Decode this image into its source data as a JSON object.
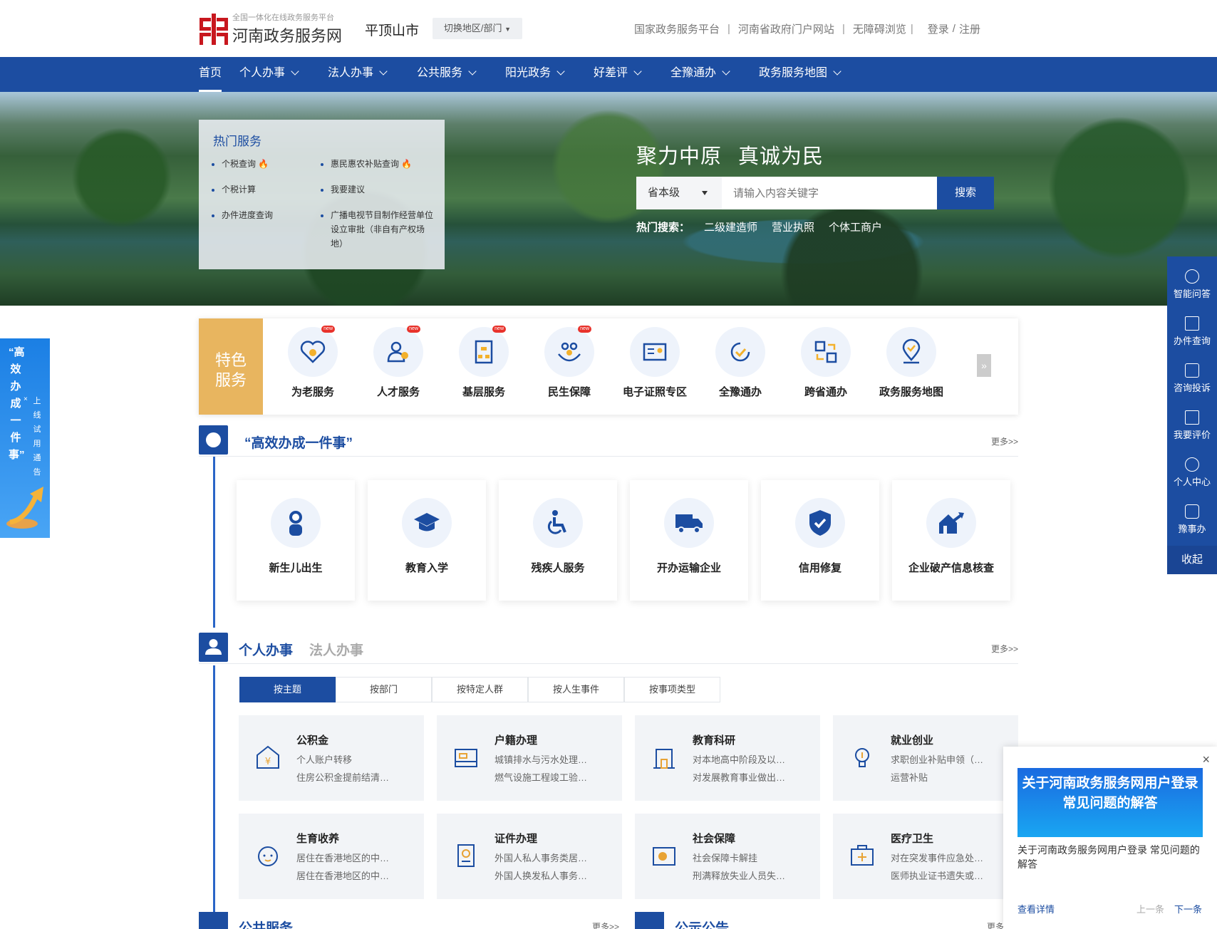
{
  "header": {
    "logo_sub": "全国一体化在线政务服务平台",
    "logo_main": "河南政务服务网",
    "city": "平顶山市",
    "switch_label": "切换地区/部门",
    "links": [
      "国家政务服务平台",
      "河南省政府门户网站",
      "无障碍浏览"
    ],
    "login": "登录",
    "register": "注册"
  },
  "nav": {
    "items": [
      "首页",
      "个人办事",
      "法人办事",
      "公共服务",
      "阳光政务",
      "好差评",
      "全豫通办",
      "政务服务地图"
    ]
  },
  "banner": {
    "hot_title": "热门服务",
    "hot_items": [
      "个税查询",
      "惠民惠农补贴查询",
      "个税计算",
      "我要建议",
      "办件进度查询",
      "广播电视节目制作经营单位设立审批（非自有产权场地）"
    ],
    "slogan": "聚力中原   真诚为民",
    "level": "省本级",
    "placeholder": "请输入内容关键字",
    "search_btn": "搜索",
    "hot_search_label": "热门搜索：",
    "hot_search": [
      "二级建造师",
      "营业执照",
      "个体工商户"
    ]
  },
  "right_sidebar": {
    "items": [
      "智能问答",
      "办件查询",
      "咨询投诉",
      "我要评价",
      "个人中心",
      "豫事办"
    ],
    "collapse": "收起"
  },
  "left_float": {
    "title": "“高效办成一件事”",
    "notice": "上线试用通告"
  },
  "feature": {
    "label1": "特色",
    "label2": "服务",
    "items": [
      "为老服务",
      "人才服务",
      "基层服务",
      "民生保障",
      "电子证照专区",
      "全豫通办",
      "跨省通办",
      "政务服务地图"
    ],
    "new_badge": "new"
  },
  "efficient": {
    "title": "“高效办成一件事”",
    "more": "更多>>",
    "items": [
      "新生儿出生",
      "教育入学",
      "残疾人服务",
      "开办运输企业",
      "信用修复",
      "企业破产信息核查"
    ]
  },
  "personal": {
    "title": "个人办事",
    "title2": "法人办事",
    "more": "更多>>",
    "tabs": [
      "按主题",
      "按部门",
      "按特定人群",
      "按人生事件",
      "按事项类型"
    ],
    "themes": [
      {
        "title": "公积金",
        "l1": "个人账户转移",
        "l2": "住房公积金提前结清…"
      },
      {
        "title": "户籍办理",
        "l1": "城镇排水与污水处理…",
        "l2": "燃气设施工程竣工验…"
      },
      {
        "title": "教育科研",
        "l1": "对本地高中阶段及以…",
        "l2": "对发展教育事业做出…"
      },
      {
        "title": "就业创业",
        "l1": "求职创业补贴申领（…",
        "l2": "运营补贴"
      },
      {
        "title": "生育收养",
        "l1": "居住在香港地区的中…",
        "l2": "居住在香港地区的中…"
      },
      {
        "title": "证件办理",
        "l1": "外国人私人事务类居…",
        "l2": "外国人换发私人事务…"
      },
      {
        "title": "社会保障",
        "l1": "社会保障卡解挂",
        "l2": "刑满释放失业人员失…"
      },
      {
        "title": "医疗卫生",
        "l1": "对在突发事件应急处…",
        "l2": "医师执业证书遗失或…"
      }
    ]
  },
  "bottom": {
    "public_service": "公共服务",
    "more": "更多>>",
    "notice": "公示公告",
    "more2": "更多"
  },
  "popup": {
    "close": "×",
    "image_text": "关于河南政务服务网用户登录常见问题的解答",
    "text": "关于河南政务服务网用户登录 常见问题的解答",
    "detail": "查看详情",
    "prev": "上一条",
    "next": "下一条"
  },
  "colors": {
    "primary": "#1c4da1",
    "feature_gold": "#e8b55f"
  }
}
